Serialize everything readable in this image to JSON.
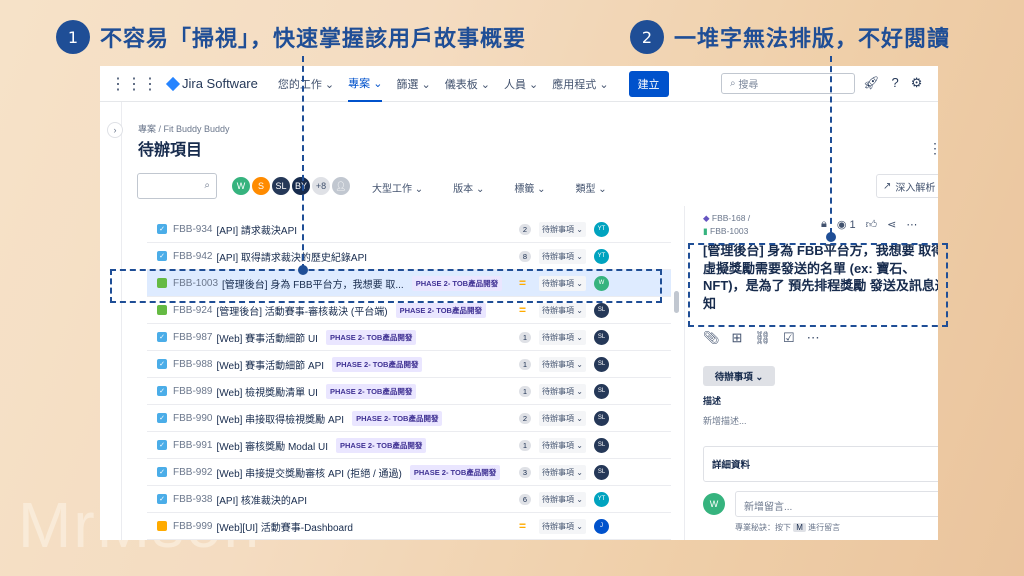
{
  "callouts": [
    {
      "number": "1",
      "text": "不容易「掃視」，快速掌握該用戶故事概要"
    },
    {
      "number": "2",
      "text": "一堆字無法排版，不好閱讀"
    }
  ],
  "watermark": "MrMson",
  "topbar": {
    "app_name": "Jira Software",
    "nav": [
      "您的工作 ⌄",
      "專案 ⌄",
      "篩選 ⌄",
      "儀表板 ⌄",
      "人員 ⌄",
      "應用程式 ⌄"
    ],
    "create_label": "建立",
    "search_placeholder": "搜尋"
  },
  "breadcrumb": "專案 / Fit Buddy Buddy",
  "page_title": "待辦項目",
  "avatars": [
    {
      "initials": "W",
      "color": "#36b37e"
    },
    {
      "initials": "S",
      "color": "#ff8b00"
    },
    {
      "initials": "SL",
      "color": "#253858"
    },
    {
      "initials": "BY",
      "color": "#172b4d"
    },
    {
      "initials": "+8",
      "color": "#dfe1e6"
    }
  ],
  "filters": [
    "大型工作 ⌄",
    "版本 ⌄",
    "標籤 ⌄",
    "類型 ⌄"
  ],
  "insight_label": "深入解析",
  "issues": [
    {
      "type": "task",
      "key": "FBB-934",
      "summary": "[API] 請求裁決API",
      "epic": "",
      "points": "2",
      "status": "待辦事項 ⌄",
      "assignee": "YT",
      "assignee_color": "#00a3bf"
    },
    {
      "type": "task",
      "key": "FBB-942",
      "summary": "[API] 取得請求裁決的歷史紀錄API",
      "epic": "",
      "points": "8",
      "status": "待辦事項 ⌄",
      "assignee": "YT",
      "assignee_color": "#00a3bf"
    },
    {
      "type": "story",
      "key": "FBB-1003",
      "summary": "[管理後台] 身為 FBB平台方，我想要 取...",
      "epic": "PHASE 2- TOB產品開發",
      "points": "=",
      "status": "待辦事項 ⌄",
      "assignee": "W",
      "assignee_color": "#36b37e"
    },
    {
      "type": "story",
      "key": "FBB-924",
      "summary": "[管理後台] 活動賽事-審核裁決 (平台端)",
      "epic": "PHASE 2- TOB產品開發",
      "points": "=",
      "status": "待辦事項 ⌄",
      "assignee": "SL",
      "assignee_color": "#253858"
    },
    {
      "type": "task",
      "key": "FBB-987",
      "summary": "[Web] 賽事活動細節 UI",
      "epic": "PHASE 2- TOB產品開發",
      "points": "1",
      "status": "待辦事項 ⌄",
      "assignee": "SL",
      "assignee_color": "#253858"
    },
    {
      "type": "task",
      "key": "FBB-988",
      "summary": "[Web] 賽事活動細節 API",
      "epic": "PHASE 2- TOB產品開發",
      "points": "1",
      "status": "待辦事項 ⌄",
      "assignee": "SL",
      "assignee_color": "#253858"
    },
    {
      "type": "task",
      "key": "FBB-989",
      "summary": "[Web] 檢視獎勵清單 UI",
      "epic": "PHASE 2- TOB產品開發",
      "points": "1",
      "status": "待辦事項 ⌄",
      "assignee": "SL",
      "assignee_color": "#253858"
    },
    {
      "type": "task",
      "key": "FBB-990",
      "summary": "[Web] 串接取得檢視獎勵 API",
      "epic": "PHASE 2- TOB產品開發",
      "points": "2",
      "status": "待辦事項 ⌄",
      "assignee": "SL",
      "assignee_color": "#253858"
    },
    {
      "type": "task",
      "key": "FBB-991",
      "summary": "[Web] 審核獎勵 Modal UI",
      "epic": "PHASE 2- TOB產品開發",
      "points": "1",
      "status": "待辦事項 ⌄",
      "assignee": "SL",
      "assignee_color": "#253858"
    },
    {
      "type": "task",
      "key": "FBB-992",
      "summary": "[Web] 串接提交獎勵審核 API (拒絕 / 通過)",
      "epic": "PHASE 2- TOB產品開發",
      "points": "3",
      "status": "待辦事項 ⌄",
      "assignee": "SL",
      "assignee_color": "#253858"
    },
    {
      "type": "task",
      "key": "FBB-938",
      "summary": "[API] 核准裁決的API",
      "epic": "",
      "points": "6",
      "status": "待辦事項 ⌄",
      "assignee": "YT",
      "assignee_color": "#00a3bf"
    },
    {
      "type": "subtask",
      "key": "FBB-999",
      "summary": "[Web][UI] 活動賽事-Dashboard",
      "epic": "",
      "points": "=",
      "status": "待辦事項 ⌄",
      "assignee": "J",
      "assignee_color": "#0052cc"
    }
  ],
  "panel": {
    "parent_key": "FBB-168 /",
    "issue_key": "FBB-1003",
    "watch_count": "1",
    "title": "[管理後台] 身為 FBB平台方，我想要 取得虛擬獎勵需要發送的名單 (ex: 寶石、NFT)，是為了 預先排程獎勵 發送及訊息通知",
    "status": "待辦事項 ⌄",
    "description_label": "描述",
    "description_placeholder": "新增描述...",
    "details_label": "詳細資料",
    "comment_avatar": "W",
    "comment_placeholder": "新增留言...",
    "tip_prefix": "專業秘訣：按下",
    "tip_key": "M",
    "tip_suffix": "進行留言"
  }
}
